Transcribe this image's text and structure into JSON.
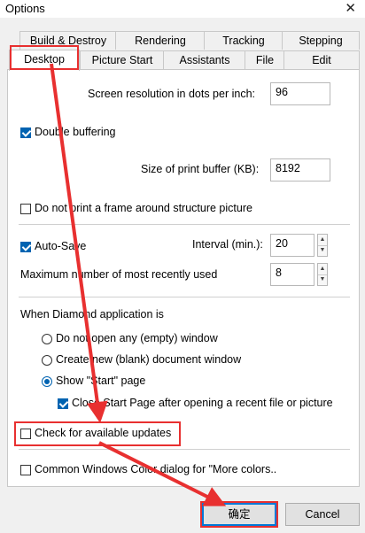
{
  "window": {
    "title": "Options",
    "close_glyph": "✕"
  },
  "tabs": {
    "row1": [
      "Build & Destroy",
      "Rendering",
      "Tracking",
      "Stepping"
    ],
    "row2": [
      "Desktop",
      "Picture Start",
      "Assistants",
      "File",
      "Edit"
    ],
    "active": "Desktop"
  },
  "desktop": {
    "resolution": {
      "label": "Screen resolution in dots per inch:",
      "value": "96"
    },
    "double_buffering": {
      "label": "Double buffering",
      "checked": true
    },
    "print_buffer": {
      "label": "Size of print buffer (KB):",
      "value": "8192"
    },
    "no_frame": {
      "label": "Do not print a frame around structure picture",
      "checked": false
    },
    "autosave": {
      "label": "Auto-Save",
      "checked": true
    },
    "interval": {
      "label": "Interval (min.):",
      "value": "20"
    },
    "mru": {
      "label": "Maximum number of most recently used",
      "value": "8"
    },
    "when_label": "When Diamond application is",
    "radios": [
      {
        "label": "Do not open any (empty) window",
        "selected": false
      },
      {
        "label": "Create new (blank) document window",
        "selected": false
      },
      {
        "label": "Show \"Start\" page",
        "selected": true
      }
    ],
    "close_start": {
      "label": "Close Start Page after opening a recent file or picture",
      "checked": true
    },
    "check_updates": {
      "label": "Check for available updates",
      "checked": false
    },
    "color_dialog": {
      "label": "Common Windows Color dialog for \"More colors..",
      "checked": false
    }
  },
  "buttons": {
    "ok": "确定",
    "cancel": "Cancel"
  },
  "icons": {
    "checkbox": "checkbox-icon",
    "radio": "radio-icon",
    "spin_up": "▲",
    "spin_down": "▼"
  },
  "colors": {
    "accent": "#0063b1",
    "highlight": "#e83030"
  }
}
